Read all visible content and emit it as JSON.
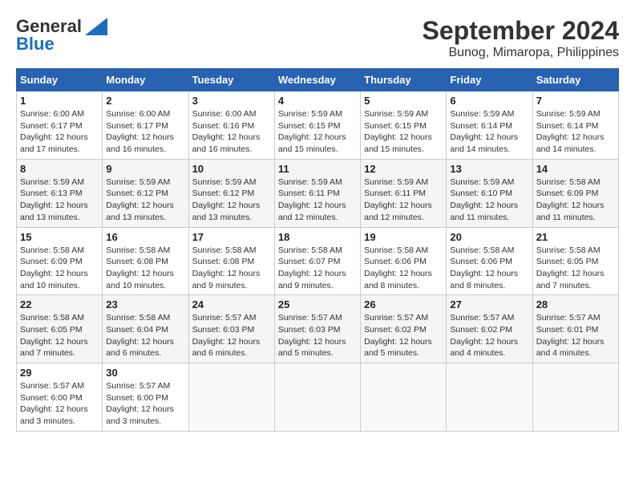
{
  "header": {
    "logo_general": "General",
    "logo_blue": "Blue",
    "title": "September 2024",
    "subtitle": "Bunog, Mimaropa, Philippines"
  },
  "calendar": {
    "days_of_week": [
      "Sunday",
      "Monday",
      "Tuesday",
      "Wednesday",
      "Thursday",
      "Friday",
      "Saturday"
    ],
    "weeks": [
      [
        null,
        null,
        null,
        null,
        null,
        null,
        null
      ]
    ],
    "cells": [
      {
        "day": "",
        "info": ""
      },
      {
        "day": "",
        "info": ""
      },
      {
        "day": "",
        "info": ""
      },
      {
        "day": "",
        "info": ""
      },
      {
        "day": "",
        "info": ""
      },
      {
        "day": "",
        "info": ""
      },
      {
        "day": "",
        "info": ""
      }
    ],
    "rows": [
      [
        {
          "day": "1",
          "sunrise": "Sunrise: 6:00 AM",
          "sunset": "Sunset: 6:17 PM",
          "daylight": "Daylight: 12 hours and 17 minutes."
        },
        {
          "day": "2",
          "sunrise": "Sunrise: 6:00 AM",
          "sunset": "Sunset: 6:17 PM",
          "daylight": "Daylight: 12 hours and 16 minutes."
        },
        {
          "day": "3",
          "sunrise": "Sunrise: 6:00 AM",
          "sunset": "Sunset: 6:16 PM",
          "daylight": "Daylight: 12 hours and 16 minutes."
        },
        {
          "day": "4",
          "sunrise": "Sunrise: 5:59 AM",
          "sunset": "Sunset: 6:15 PM",
          "daylight": "Daylight: 12 hours and 15 minutes."
        },
        {
          "day": "5",
          "sunrise": "Sunrise: 5:59 AM",
          "sunset": "Sunset: 6:15 PM",
          "daylight": "Daylight: 12 hours and 15 minutes."
        },
        {
          "day": "6",
          "sunrise": "Sunrise: 5:59 AM",
          "sunset": "Sunset: 6:14 PM",
          "daylight": "Daylight: 12 hours and 14 minutes."
        },
        {
          "day": "7",
          "sunrise": "Sunrise: 5:59 AM",
          "sunset": "Sunset: 6:14 PM",
          "daylight": "Daylight: 12 hours and 14 minutes."
        }
      ],
      [
        {
          "day": "8",
          "sunrise": "Sunrise: 5:59 AM",
          "sunset": "Sunset: 6:13 PM",
          "daylight": "Daylight: 12 hours and 13 minutes."
        },
        {
          "day": "9",
          "sunrise": "Sunrise: 5:59 AM",
          "sunset": "Sunset: 6:12 PM",
          "daylight": "Daylight: 12 hours and 13 minutes."
        },
        {
          "day": "10",
          "sunrise": "Sunrise: 5:59 AM",
          "sunset": "Sunset: 6:12 PM",
          "daylight": "Daylight: 12 hours and 13 minutes."
        },
        {
          "day": "11",
          "sunrise": "Sunrise: 5:59 AM",
          "sunset": "Sunset: 6:11 PM",
          "daylight": "Daylight: 12 hours and 12 minutes."
        },
        {
          "day": "12",
          "sunrise": "Sunrise: 5:59 AM",
          "sunset": "Sunset: 6:11 PM",
          "daylight": "Daylight: 12 hours and 12 minutes."
        },
        {
          "day": "13",
          "sunrise": "Sunrise: 5:59 AM",
          "sunset": "Sunset: 6:10 PM",
          "daylight": "Daylight: 12 hours and 11 minutes."
        },
        {
          "day": "14",
          "sunrise": "Sunrise: 5:58 AM",
          "sunset": "Sunset: 6:09 PM",
          "daylight": "Daylight: 12 hours and 11 minutes."
        }
      ],
      [
        {
          "day": "15",
          "sunrise": "Sunrise: 5:58 AM",
          "sunset": "Sunset: 6:09 PM",
          "daylight": "Daylight: 12 hours and 10 minutes."
        },
        {
          "day": "16",
          "sunrise": "Sunrise: 5:58 AM",
          "sunset": "Sunset: 6:08 PM",
          "daylight": "Daylight: 12 hours and 10 minutes."
        },
        {
          "day": "17",
          "sunrise": "Sunrise: 5:58 AM",
          "sunset": "Sunset: 6:08 PM",
          "daylight": "Daylight: 12 hours and 9 minutes."
        },
        {
          "day": "18",
          "sunrise": "Sunrise: 5:58 AM",
          "sunset": "Sunset: 6:07 PM",
          "daylight": "Daylight: 12 hours and 9 minutes."
        },
        {
          "day": "19",
          "sunrise": "Sunrise: 5:58 AM",
          "sunset": "Sunset: 6:06 PM",
          "daylight": "Daylight: 12 hours and 8 minutes."
        },
        {
          "day": "20",
          "sunrise": "Sunrise: 5:58 AM",
          "sunset": "Sunset: 6:06 PM",
          "daylight": "Daylight: 12 hours and 8 minutes."
        },
        {
          "day": "21",
          "sunrise": "Sunrise: 5:58 AM",
          "sunset": "Sunset: 6:05 PM",
          "daylight": "Daylight: 12 hours and 7 minutes."
        }
      ],
      [
        {
          "day": "22",
          "sunrise": "Sunrise: 5:58 AM",
          "sunset": "Sunset: 6:05 PM",
          "daylight": "Daylight: 12 hours and 7 minutes."
        },
        {
          "day": "23",
          "sunrise": "Sunrise: 5:58 AM",
          "sunset": "Sunset: 6:04 PM",
          "daylight": "Daylight: 12 hours and 6 minutes."
        },
        {
          "day": "24",
          "sunrise": "Sunrise: 5:57 AM",
          "sunset": "Sunset: 6:03 PM",
          "daylight": "Daylight: 12 hours and 6 minutes."
        },
        {
          "day": "25",
          "sunrise": "Sunrise: 5:57 AM",
          "sunset": "Sunset: 6:03 PM",
          "daylight": "Daylight: 12 hours and 5 minutes."
        },
        {
          "day": "26",
          "sunrise": "Sunrise: 5:57 AM",
          "sunset": "Sunset: 6:02 PM",
          "daylight": "Daylight: 12 hours and 5 minutes."
        },
        {
          "day": "27",
          "sunrise": "Sunrise: 5:57 AM",
          "sunset": "Sunset: 6:02 PM",
          "daylight": "Daylight: 12 hours and 4 minutes."
        },
        {
          "day": "28",
          "sunrise": "Sunrise: 5:57 AM",
          "sunset": "Sunset: 6:01 PM",
          "daylight": "Daylight: 12 hours and 4 minutes."
        }
      ],
      [
        {
          "day": "29",
          "sunrise": "Sunrise: 5:57 AM",
          "sunset": "Sunset: 6:00 PM",
          "daylight": "Daylight: 12 hours and 3 minutes."
        },
        {
          "day": "30",
          "sunrise": "Sunrise: 5:57 AM",
          "sunset": "Sunset: 6:00 PM",
          "daylight": "Daylight: 12 hours and 3 minutes."
        },
        {
          "day": "",
          "sunrise": "",
          "sunset": "",
          "daylight": ""
        },
        {
          "day": "",
          "sunrise": "",
          "sunset": "",
          "daylight": ""
        },
        {
          "day": "",
          "sunrise": "",
          "sunset": "",
          "daylight": ""
        },
        {
          "day": "",
          "sunrise": "",
          "sunset": "",
          "daylight": ""
        },
        {
          "day": "",
          "sunrise": "",
          "sunset": "",
          "daylight": ""
        }
      ]
    ]
  }
}
